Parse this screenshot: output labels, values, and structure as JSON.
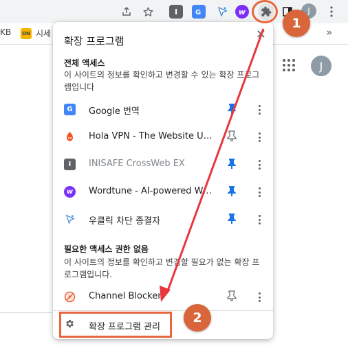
{
  "bookmarks": {
    "item1": "KB",
    "item2_badge": "ON",
    "item2": "시세",
    "more": "»"
  },
  "toolbar": {
    "ext_inisafe_letter": "I",
    "ext_wordtune_letter": "w",
    "avatar_letter": "J",
    "icons": [
      "share-icon",
      "star-icon",
      "inisafe-icon",
      "google-translate-icon",
      "ublock-icon",
      "wordtune-icon",
      "puzzle-icon",
      "side-panel-icon",
      "avatar",
      "more-vert-icon"
    ]
  },
  "page": {
    "avatar_letter": "J"
  },
  "popup": {
    "title": "확장 프로그램",
    "close": "✕",
    "full_access": {
      "heading": "전체 액세스",
      "description": "이 사이트의 정보를 확인하고 변경할 수 있는 확장 프로그램입니다",
      "items": [
        {
          "label": "Google 번역",
          "pinned": true,
          "icon": "google-translate-icon"
        },
        {
          "label": "Hola VPN - The Website Unblocker",
          "pinned": false,
          "icon": "hola-vpn-icon"
        },
        {
          "label": "INISAFE CrossWeb EX",
          "pinned": true,
          "icon": "inisafe-icon"
        },
        {
          "label": "Wordtune - AI-powered Writing Companion",
          "pinned": true,
          "icon": "wordtune-icon"
        },
        {
          "label": "우클릭 차단 종결자",
          "pinned": true,
          "icon": "ublock-icon"
        }
      ]
    },
    "no_access": {
      "heading": "필요한 액세스 권한 없음",
      "description": "이 사이트의 정보를 확인하고 변경할 필요가 없는 확장 프로그램입니다.",
      "items": [
        {
          "label": "Channel Blocker",
          "pinned": false,
          "icon": "channel-blocker-icon"
        }
      ]
    },
    "manage_label": "확장 프로그램 관리"
  },
  "annotations": {
    "badge1": "1",
    "badge2": "2"
  },
  "colors": {
    "accent_pin": "#1a73e8",
    "annotation": "#e8663d"
  }
}
